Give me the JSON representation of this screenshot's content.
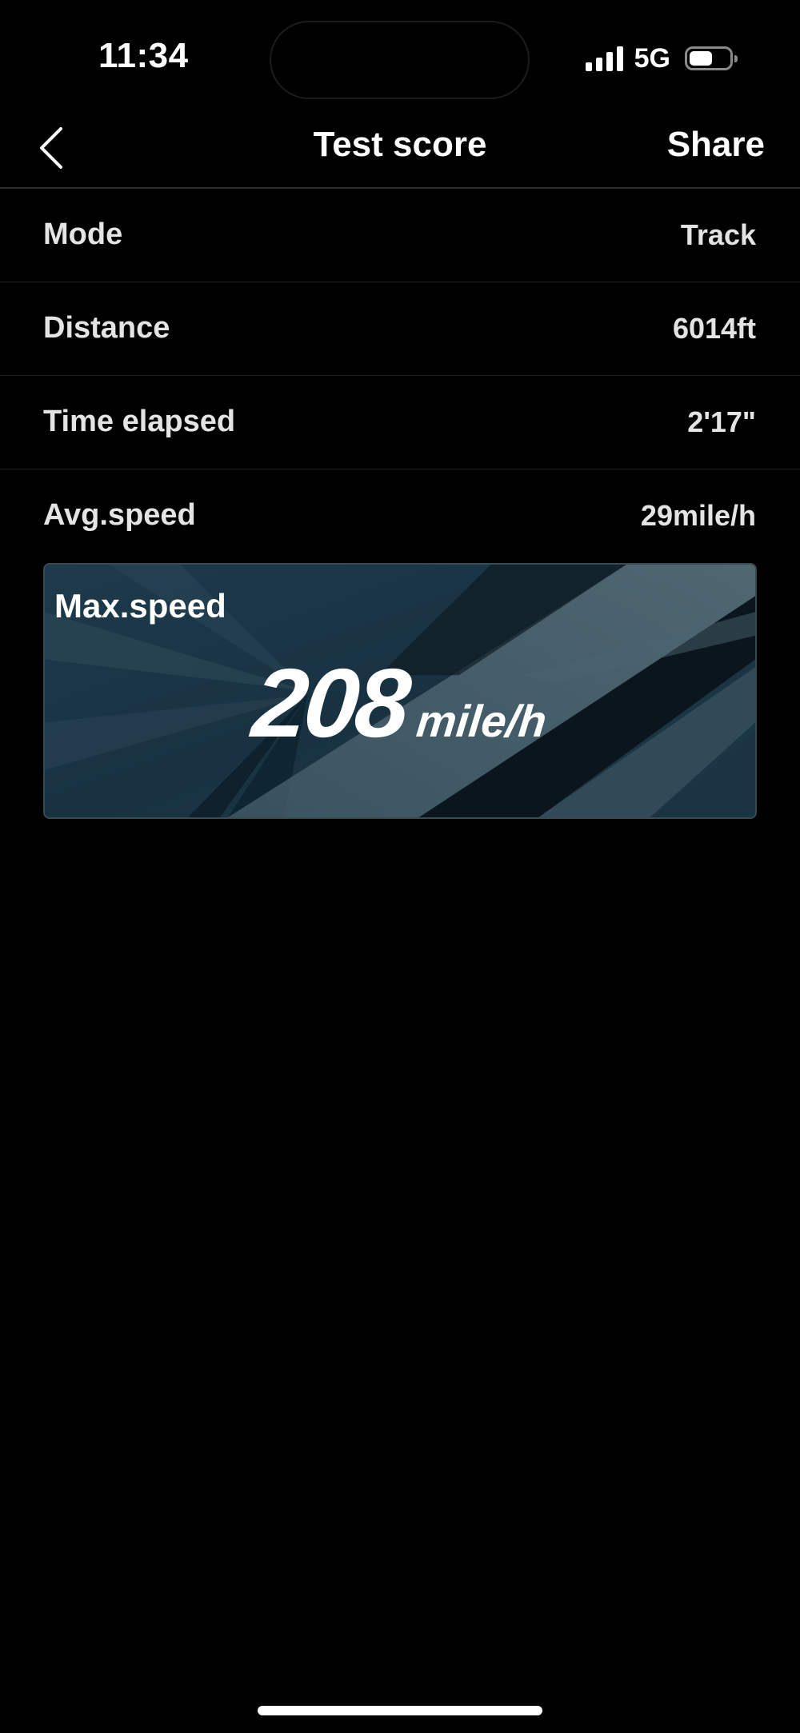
{
  "status_bar": {
    "time": "11:34",
    "network": "5G",
    "battery_level": 0.58,
    "icons": [
      "signal-icon",
      "battery-icon"
    ]
  },
  "nav": {
    "title": "Test score",
    "share_label": "Share",
    "back_icon": "chevron-left-icon"
  },
  "stats": [
    {
      "label": "Mode",
      "value": "Track"
    },
    {
      "label": "Distance",
      "value": "6014ft"
    },
    {
      "label": "Time elapsed",
      "value": "2'17\""
    },
    {
      "label": "Avg.speed",
      "value": "29mile/h"
    }
  ],
  "max_speed": {
    "label": "Max.speed",
    "value": "208",
    "unit": "mile/h"
  },
  "colors": {
    "background": "#000000",
    "card_base": "#1b3342",
    "text": "#ffffff"
  }
}
